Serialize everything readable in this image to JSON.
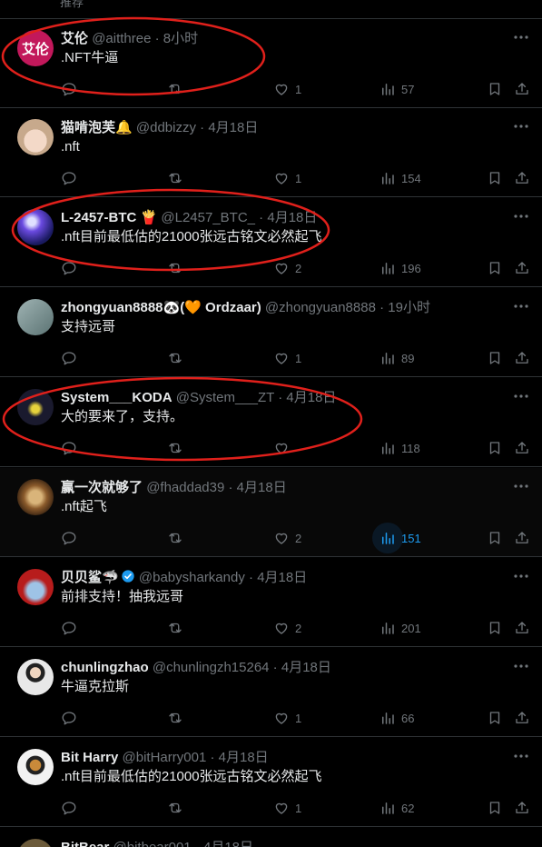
{
  "top_fragment": "推荐",
  "posts": [
    {
      "name": "艾伦",
      "handle": "@aitthree",
      "time": "8小时",
      "text": ".NFT牛逼",
      "replies": "",
      "reposts": "",
      "likes": "1",
      "views": "57",
      "avatar_text": "艾伦",
      "avatar_color": "#c2185b"
    },
    {
      "name": "猫啃泡芙",
      "handle": "@ddbizzy",
      "time": "4月18日",
      "text": ".nft",
      "replies": "",
      "reposts": "",
      "likes": "1",
      "views": "154",
      "avatar_color": "#c7a98c"
    },
    {
      "name": "L-2457-BTC",
      "handle": "@L2457_BTC_",
      "time": "4月18日",
      "text": ".nft目前最低估的21000张远古铭文必然起飞",
      "replies": "",
      "reposts": "",
      "likes": "2",
      "views": "196",
      "avatar_color": "#3a3fd1"
    },
    {
      "name": "zhongyuan8888",
      "name_suffix": "(🧡 Ordzaar)",
      "handle": "@zhongyuan8888",
      "time": "19小时",
      "text": "支持远哥",
      "replies": "",
      "reposts": "",
      "likes": "1",
      "views": "89",
      "avatar_color": "#6f8a8a"
    },
    {
      "name": "System___KODA",
      "handle": "@System___ZT",
      "time": "4月18日",
      "text": "大的要来了，支持。",
      "replies": "",
      "reposts": "",
      "likes": "",
      "views": "118",
      "avatar_color": "#1a1a2e"
    },
    {
      "name": "赢一次就够了",
      "handle": "@fhaddad39",
      "time": "4月18日",
      "text": ".nft起飞",
      "replies": "",
      "reposts": "",
      "likes": "2",
      "views": "151",
      "avatar_color": "#8a5a2b"
    },
    {
      "name": "贝贝鲨",
      "handle": "@babysharkandy",
      "time": "4月18日",
      "text": "前排支持！抽我远哥",
      "replies": "",
      "reposts": "",
      "likes": "2",
      "views": "201",
      "avatar_color": "#b71c1c"
    },
    {
      "name": "chunlingzhao",
      "handle": "@chunlingzh15264",
      "time": "4月18日",
      "text": "牛逼克拉斯",
      "replies": "",
      "reposts": "",
      "likes": "1",
      "views": "66",
      "avatar_color": "#e8e8e8"
    },
    {
      "name": "Bit Harry",
      "handle": "@bitHarry001",
      "time": "4月18日",
      "text": ".nft目前最低估的21000张远古铭文必然起飞",
      "replies": "",
      "reposts": "",
      "likes": "1",
      "views": "62",
      "avatar_color": "#f2f2f2"
    }
  ],
  "partial_post": {
    "name": "BitBear",
    "handle": "@bitbear001",
    "time": "4月18日"
  },
  "accent_color": "#1d9bf0",
  "annotation_color": "#e0201b",
  "icons": [
    "reply-icon",
    "repost-icon",
    "like-icon",
    "views-icon",
    "bookmark-icon",
    "share-icon",
    "more-icon",
    "verified-icon"
  ]
}
